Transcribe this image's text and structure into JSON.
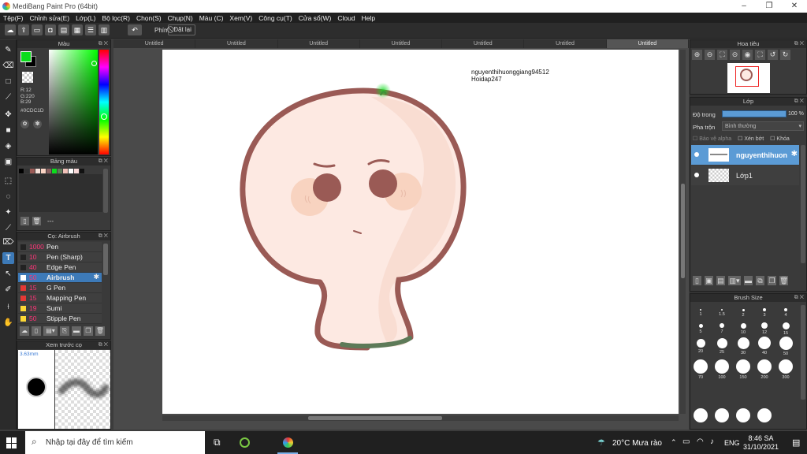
{
  "window": {
    "title": "MediBang Paint Pro (64bit)"
  },
  "menu": [
    "Tệp(F)",
    "Chỉnh sửa(E)",
    "Lớp(L)",
    "Bộ lọc(R)",
    "Chọn(S)",
    "Chụp(N)",
    "Màu (C)",
    "Xem(V)",
    "Công cụ(T)",
    "Cửa sổ(W)",
    "Cloud",
    "Help"
  ],
  "toolbar": {
    "mode_label": "Phím",
    "reset_label": "Đặt lại"
  },
  "color_panel": {
    "title": "Màu",
    "r": "R:12",
    "g": "G:220",
    "b": "B:29",
    "hex": "#0CDC1D",
    "current_color": "#0CDC1D"
  },
  "palette_panel": {
    "title": "Bảng màu",
    "more": "---"
  },
  "brush_panel": {
    "title": "Cọ: Airbrush",
    "items": [
      {
        "size": "1000",
        "name": "Pen",
        "color": "#222222"
      },
      {
        "size": "10",
        "name": "Pen (Sharp)",
        "color": "#222222"
      },
      {
        "size": "40",
        "name": "Edge Pen",
        "color": "#222222"
      },
      {
        "size": "50",
        "name": "Airbrush",
        "color": "#ffffff"
      },
      {
        "size": "15",
        "name": "G Pen",
        "color": "#e53935"
      },
      {
        "size": "15",
        "name": "Mapping Pen",
        "color": "#e53935"
      },
      {
        "size": "19",
        "name": "Sumi",
        "color": "#fdd835"
      },
      {
        "size": "50",
        "name": "Stipple Pen",
        "color": "#fdd835"
      }
    ]
  },
  "preview_panel": {
    "title": "Xem trước cọ",
    "size": "3.63mm"
  },
  "tabs": [
    "Untitled",
    "Untitled",
    "Untitled",
    "Untitled",
    "Untitled",
    "Untitled",
    "Untitled"
  ],
  "canvas_text": {
    "line1": "nguyenthihuonggiang94512",
    "line2": "Hoidap247"
  },
  "navigator": {
    "title": "Hoa tiêu"
  },
  "layer_panel": {
    "title": "Lớp",
    "opacity_label": "Độ trong",
    "opacity_value": "100 %",
    "blend_label": "Pha trộn",
    "blend_value": "Bình thường",
    "protect_alpha": "Bảo vệ alpha",
    "clipping": "Xén bớt",
    "lock": "Khóa",
    "layers": [
      {
        "name": "nguyenthihuon"
      },
      {
        "name": "Lớp1"
      }
    ]
  },
  "brush_size": {
    "title": "Brush Size",
    "labels": [
      "1",
      "1.5",
      "2",
      "3",
      "4",
      "5",
      "7",
      "10",
      "12",
      "15",
      "20",
      "25",
      "30",
      "40",
      "50",
      "70",
      "100",
      "150",
      "200",
      "300"
    ]
  },
  "taskbar": {
    "search_placeholder": "Nhập tại đây để tìm kiếm",
    "weather": "20°C  Mưa rào",
    "lang": "ENG",
    "time": "8:46 SA",
    "date": "31/10/2021"
  }
}
